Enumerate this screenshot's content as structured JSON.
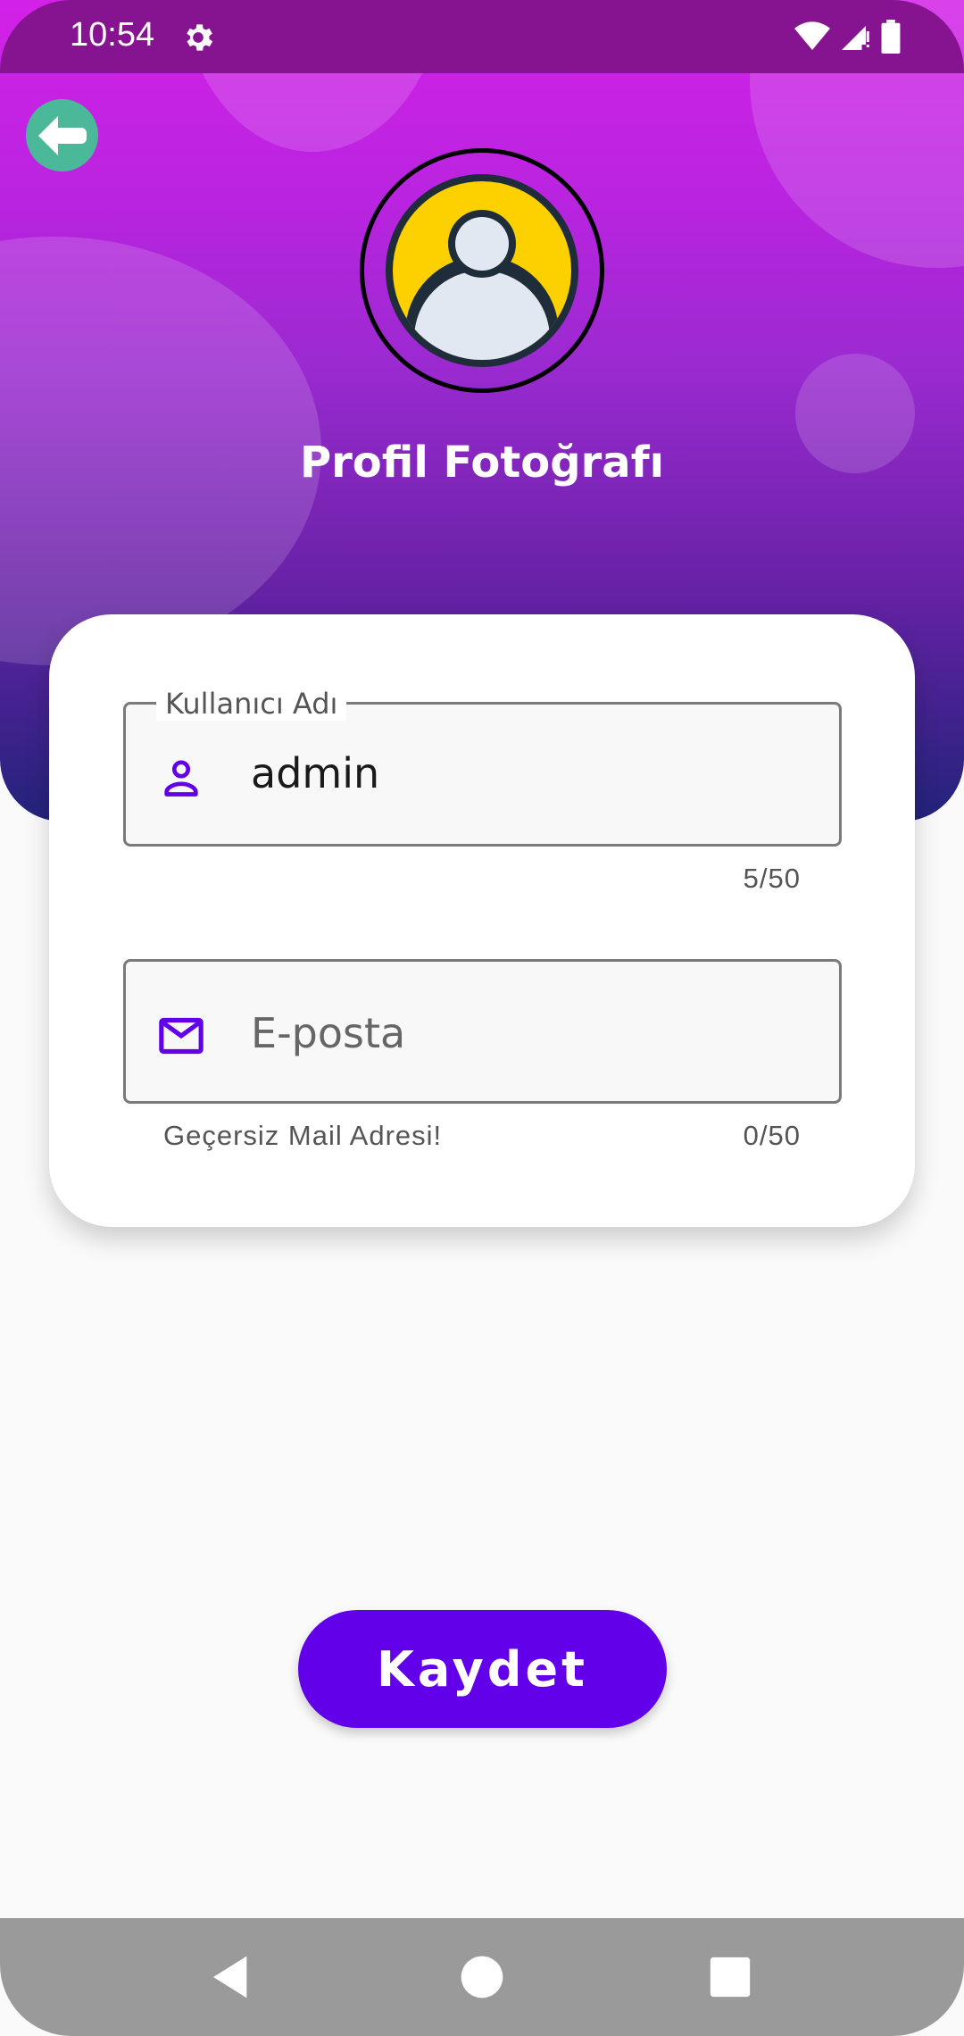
{
  "status_bar": {
    "time": "10:54"
  },
  "header": {
    "title": "Profil Fotoğrafı"
  },
  "form": {
    "username": {
      "label": "Kullanıcı Adı",
      "value": "admin",
      "counter": "5/50"
    },
    "email": {
      "placeholder": "E-posta",
      "value": "",
      "error": "Geçersiz Mail Adresi!",
      "counter": "0/50"
    }
  },
  "actions": {
    "save_label": "Kaydet"
  },
  "colors": {
    "accent": "#6200ea",
    "back_button": "#4bb89a",
    "avatar_fill": "#fdd000",
    "icon_color": "#6200ea"
  },
  "icons": {
    "back": "arrow-left-icon",
    "user": "person-icon",
    "mail": "mail-icon",
    "settings": "gear-icon"
  }
}
